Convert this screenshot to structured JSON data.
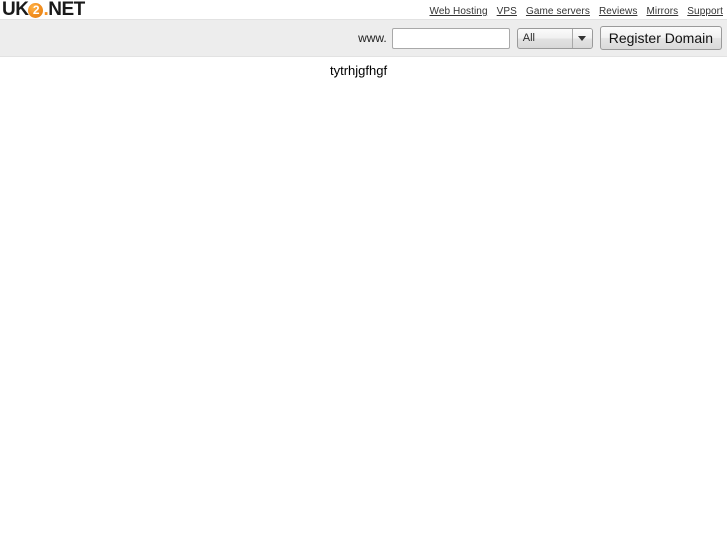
{
  "header": {
    "logo": {
      "part1": "UK",
      "badge": "2",
      "dot": ".",
      "part2": "NET",
      "accent_color": "#f59324"
    },
    "nav": {
      "items": [
        {
          "label": "Web Hosting",
          "name": "nav-link-web-hosting"
        },
        {
          "label": "VPS",
          "name": "nav-link-vps"
        },
        {
          "label": "Game servers",
          "name": "nav-link-game-servers"
        },
        {
          "label": "Reviews",
          "name": "nav-link-reviews"
        },
        {
          "label": "Mirrors",
          "name": "nav-link-mirrors"
        },
        {
          "label": "Support",
          "name": "nav-link-support"
        }
      ]
    }
  },
  "search": {
    "prefix_label": "www.",
    "input_value": "",
    "input_placeholder": "",
    "tld_selected": "All",
    "tld_options": [
      "All"
    ],
    "submit_label": "Register Domain",
    "band_color": "#ededed"
  },
  "content": {
    "text": "tytrhjgfhgf"
  }
}
